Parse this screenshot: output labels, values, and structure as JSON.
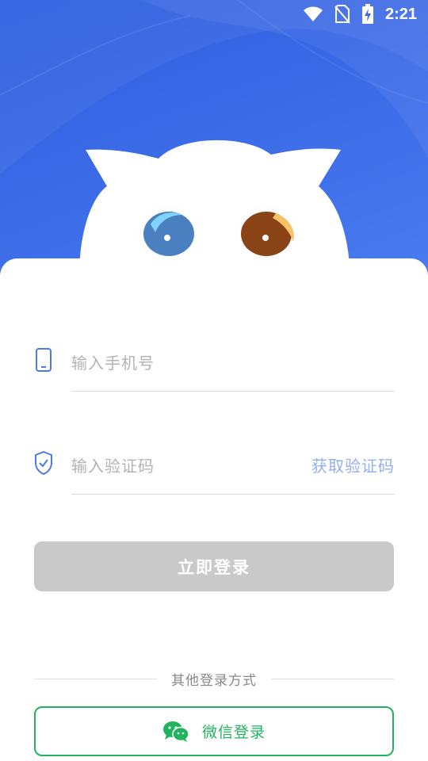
{
  "status_bar": {
    "time": "2:21",
    "icons": [
      "wifi-icon",
      "no-sim-icon",
      "battery-charging-icon"
    ]
  },
  "colors": {
    "hero_blue": "#3a6ae6",
    "accent_link": "#93aef0",
    "disabled_button": "#c9c9c9",
    "wechat_green": "#22b35e"
  },
  "form": {
    "phone": {
      "icon": "phone-icon",
      "placeholder": "输入手机号"
    },
    "code": {
      "icon": "shield-check-icon",
      "placeholder": "输入验证码",
      "get_code_label": "获取验证码"
    },
    "login_label": "立即登录"
  },
  "other_login": {
    "divider_text": "其他登录方式",
    "wechat_icon": "wechat-icon",
    "wechat_label": "微信登录"
  }
}
